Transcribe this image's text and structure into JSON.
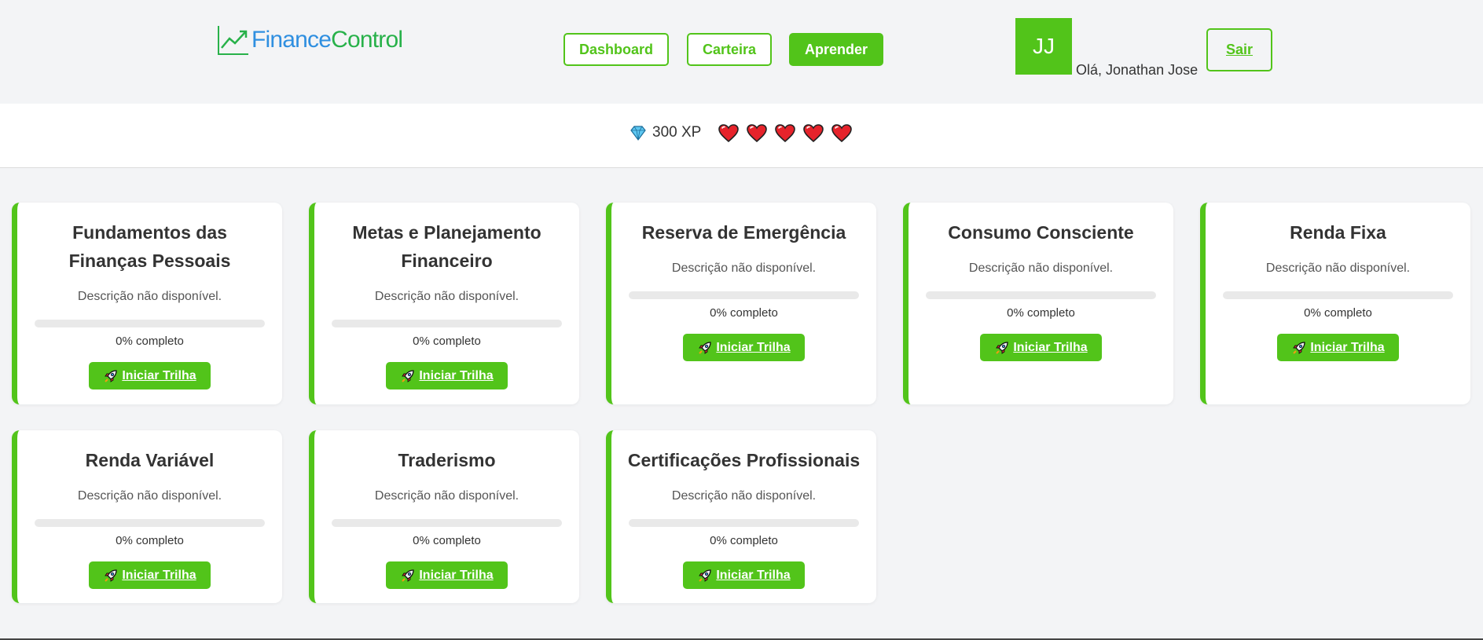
{
  "brand": {
    "part1": "Finance",
    "part2": "Control",
    "color1": "#2f8fe0",
    "color2": "#28b14a",
    "icon": "trending-up-icon"
  },
  "nav": [
    {
      "label": "Dashboard",
      "active": false
    },
    {
      "label": "Carteira",
      "active": false
    },
    {
      "label": "Aprender",
      "active": true
    }
  ],
  "user": {
    "initials": "JJ",
    "greeting": "Olá, Jonathan Jose",
    "logout_label": "Sair"
  },
  "status": {
    "xp_label": "300 XP",
    "xp_icon": "diamond-icon",
    "lives": 5,
    "life_icon": "heart-icon"
  },
  "accent_color": "#52c41a",
  "tracks": [
    {
      "title_lines": [
        "Fundamentos das",
        "Finanças Pessoais"
      ],
      "description": "Descrição não disponível.",
      "progress": 0,
      "progress_label": "0% completo",
      "button_label": "Iniciar Trilha"
    },
    {
      "title_lines": [
        "Metas e Planejamento",
        "Financeiro"
      ],
      "description": "Descrição não disponível.",
      "progress": 0,
      "progress_label": "0% completo",
      "button_label": "Iniciar Trilha"
    },
    {
      "title_lines": [
        "Reserva de Emergência"
      ],
      "description": "Descrição não disponível.",
      "progress": 0,
      "progress_label": "0% completo",
      "button_label": "Iniciar Trilha"
    },
    {
      "title_lines": [
        "Consumo Consciente"
      ],
      "description": "Descrição não disponível.",
      "progress": 0,
      "progress_label": "0% completo",
      "button_label": "Iniciar Trilha"
    },
    {
      "title_lines": [
        "Renda Fixa"
      ],
      "description": "Descrição não disponível.",
      "progress": 0,
      "progress_label": "0% completo",
      "button_label": "Iniciar Trilha"
    },
    {
      "title_lines": [
        "Renda Variável"
      ],
      "description": "Descrição não disponível.",
      "progress": 0,
      "progress_label": "0% completo",
      "button_label": "Iniciar Trilha"
    },
    {
      "title_lines": [
        "Traderismo"
      ],
      "description": "Descrição não disponível.",
      "progress": 0,
      "progress_label": "0% completo",
      "button_label": "Iniciar Trilha"
    },
    {
      "title_lines": [
        "Certificações Profissionais"
      ],
      "description": "Descrição não disponível.",
      "progress": 0,
      "progress_label": "0% completo",
      "button_label": "Iniciar Trilha"
    }
  ]
}
